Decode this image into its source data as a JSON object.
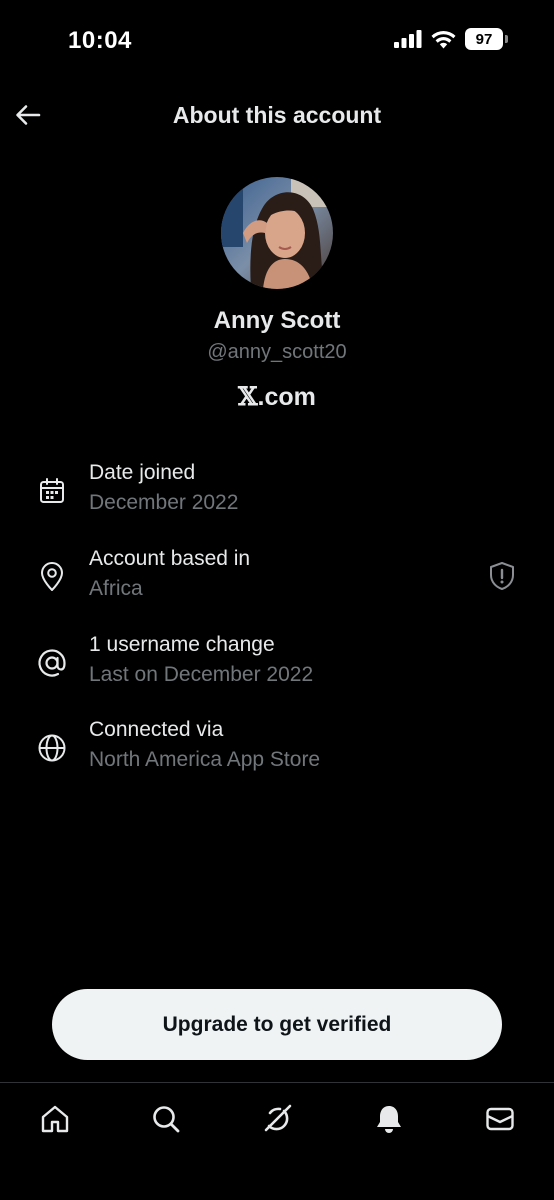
{
  "status_bar": {
    "time": "10:04",
    "battery_level": "97",
    "icons": [
      "signal-icon",
      "wifi-icon",
      "battery-icon"
    ]
  },
  "header": {
    "title": "About this account",
    "back_icon": "arrow-left-icon"
  },
  "profile": {
    "name": "Anny Scott",
    "handle": "@anny_scott20",
    "domain_prefix": "𝕏",
    "domain_suffix": ".com"
  },
  "info": [
    {
      "icon": "calendar-icon",
      "title": "Date joined",
      "subtitle": "December 2022"
    },
    {
      "icon": "location-pin-icon",
      "title": "Account based in",
      "subtitle": "Africa",
      "trailing_icon": "shield-alert-icon"
    },
    {
      "icon": "at-sign-icon",
      "title": "1 username change",
      "subtitle": "Last on December 2022"
    },
    {
      "icon": "globe-icon",
      "title": "Connected via",
      "subtitle": "North America App Store"
    }
  ],
  "upgrade_button": {
    "label": "Upgrade to get verified"
  },
  "bottom_nav": {
    "items": [
      "home-icon",
      "search-icon",
      "grok-icon",
      "notifications-icon",
      "messages-icon"
    ]
  },
  "colors": {
    "background": "#000000",
    "primary_text": "#e7e9ea",
    "secondary_text": "#71767b",
    "button_bg": "#eff3f4",
    "button_text": "#0f1419",
    "divider": "#2f3336"
  }
}
